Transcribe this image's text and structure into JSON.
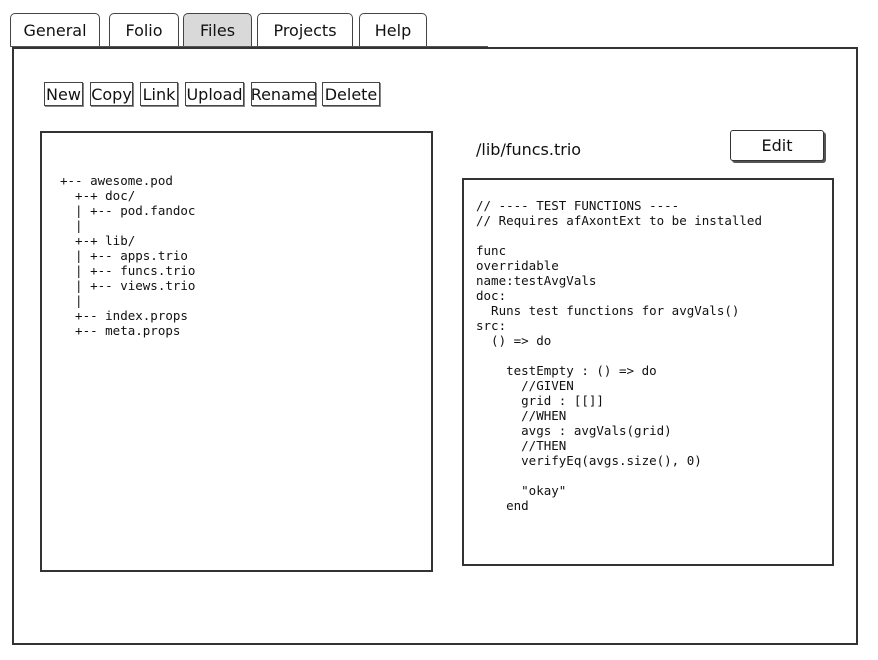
{
  "tabs": [
    {
      "label": "General",
      "active": false
    },
    {
      "label": "Folio",
      "active": false
    },
    {
      "label": "Files",
      "active": true
    },
    {
      "label": "Projects",
      "active": false
    },
    {
      "label": "Help",
      "active": false
    }
  ],
  "toolbar": {
    "new_label": "New",
    "copy_label": "Copy",
    "link_label": "Link",
    "upload_label": "Upload",
    "rename_label": "Rename",
    "delete_label": "Delete"
  },
  "file_tree": [
    "+-- awesome.pod",
    "  +-+ doc/",
    "  | +-- pod.fandoc",
    "  |",
    "  +-+ lib/",
    "  | +-- apps.trio",
    "  | +-- funcs.trio",
    "  | +-- views.trio",
    "  |",
    "  +-- index.props",
    "  +-- meta.props"
  ],
  "editor": {
    "path": "/lib/funcs.trio",
    "edit_label": "Edit",
    "lines": [
      "// ---- TEST FUNCTIONS ----",
      "// Requires afAxontExt to be installed",
      "",
      "func",
      "overridable",
      "name:testAvgVals",
      "doc:",
      "  Runs test functions for avgVals()",
      "src:",
      "  () => do",
      "",
      "    testEmpty : () => do",
      "      //GIVEN",
      "      grid : [[]]",
      "      //WHEN",
      "      avgs : avgVals(grid)",
      "      //THEN",
      "      verifyEq(avgs.size(), 0)",
      "",
      "      \"okay\"",
      "    end"
    ]
  }
}
